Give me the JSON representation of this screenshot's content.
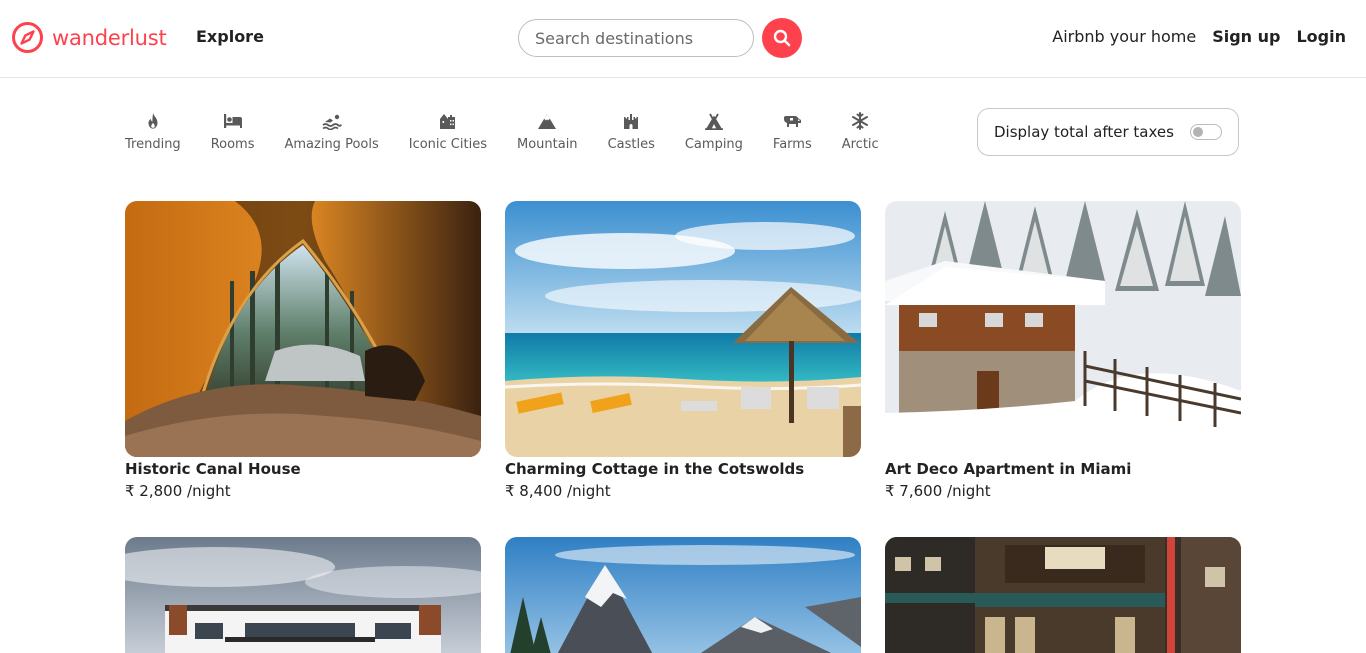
{
  "brand": {
    "name": "wanderlust"
  },
  "nav": {
    "explore": "Explore",
    "search_placeholder": "Search destinations",
    "host": "Airbnb your home",
    "signup": "Sign up",
    "login": "Login"
  },
  "colors": {
    "brand": "#fe424d",
    "text": "#222222",
    "border": "#e4e4e4"
  },
  "filters": [
    {
      "label": "Trending",
      "icon": "fire-icon"
    },
    {
      "label": "Rooms",
      "icon": "bed-icon"
    },
    {
      "label": "Amazing Pools",
      "icon": "swimmer-icon"
    },
    {
      "label": "Iconic Cities",
      "icon": "city-icon"
    },
    {
      "label": "Mountain",
      "icon": "mountain-icon"
    },
    {
      "label": "Castles",
      "icon": "castle-icon"
    },
    {
      "label": "Camping",
      "icon": "campground-icon"
    },
    {
      "label": "Farms",
      "icon": "cow-icon"
    },
    {
      "label": "Arctic",
      "icon": "snowflake-icon"
    }
  ],
  "tax_toggle": {
    "label": "Display total after taxes",
    "enabled": false
  },
  "listings": [
    {
      "title": "Historic Canal House",
      "price": "₹ 2,800 /night",
      "image": "tent-forest-photo"
    },
    {
      "title": "Charming Cottage in the Cotswolds",
      "price": "₹ 8,400 /night",
      "image": "beach-umbrella-photo"
    },
    {
      "title": "Art Deco Apartment in Miami",
      "price": "₹ 7,600 /night",
      "image": "snowy-chalet-photo"
    },
    {
      "title": "",
      "price": "",
      "image": "modern-villa-photo"
    },
    {
      "title": "",
      "price": "",
      "image": "mountain-peak-photo"
    },
    {
      "title": "",
      "price": "",
      "image": "japanese-shop-photo"
    }
  ]
}
